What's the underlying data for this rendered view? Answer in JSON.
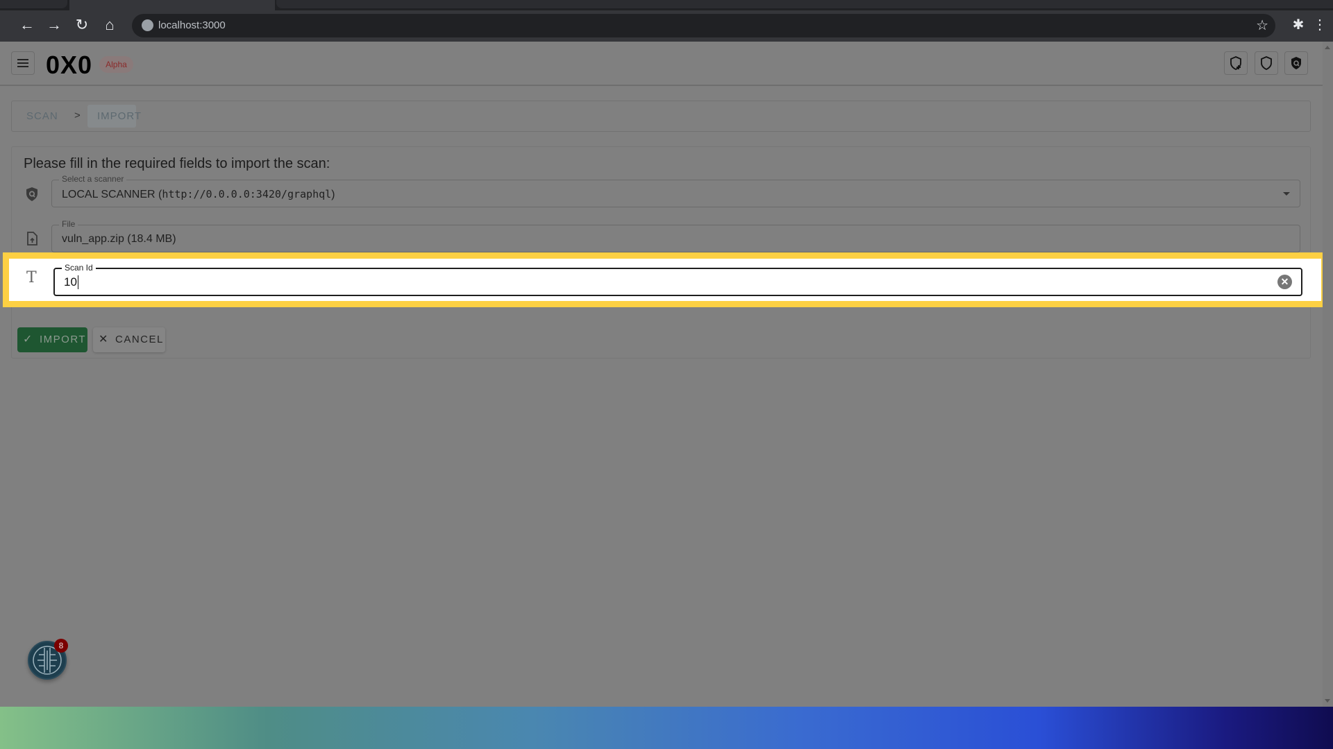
{
  "browser": {
    "url": "localhost:3000"
  },
  "header": {
    "logo": "0X0",
    "badge": "Alpha",
    "icons": [
      "shield-add-icon",
      "shield-icon",
      "shield-search-icon"
    ]
  },
  "breadcrumb": {
    "items": [
      "SCAN",
      "IMPORT"
    ],
    "separator": ">"
  },
  "form": {
    "title": "Please fill in the required fields to import the scan:",
    "scanner": {
      "label": "Select a scanner",
      "value_name": "LOCAL SCANNER (",
      "value_url": "http://0.0.0.0:3420/graphql",
      "value_close": ")"
    },
    "file": {
      "label": "File",
      "value": "vuln_app.zip (18.4 MB)"
    },
    "scan_id": {
      "label": "Scan Id",
      "value": "10"
    },
    "import_label": "IMPORT",
    "cancel_label": "CANCEL"
  },
  "notifications": {
    "count": "8"
  },
  "colors": {
    "highlight": "#fdd043",
    "import_button": "#1e5631",
    "badge": "#7a0000"
  }
}
